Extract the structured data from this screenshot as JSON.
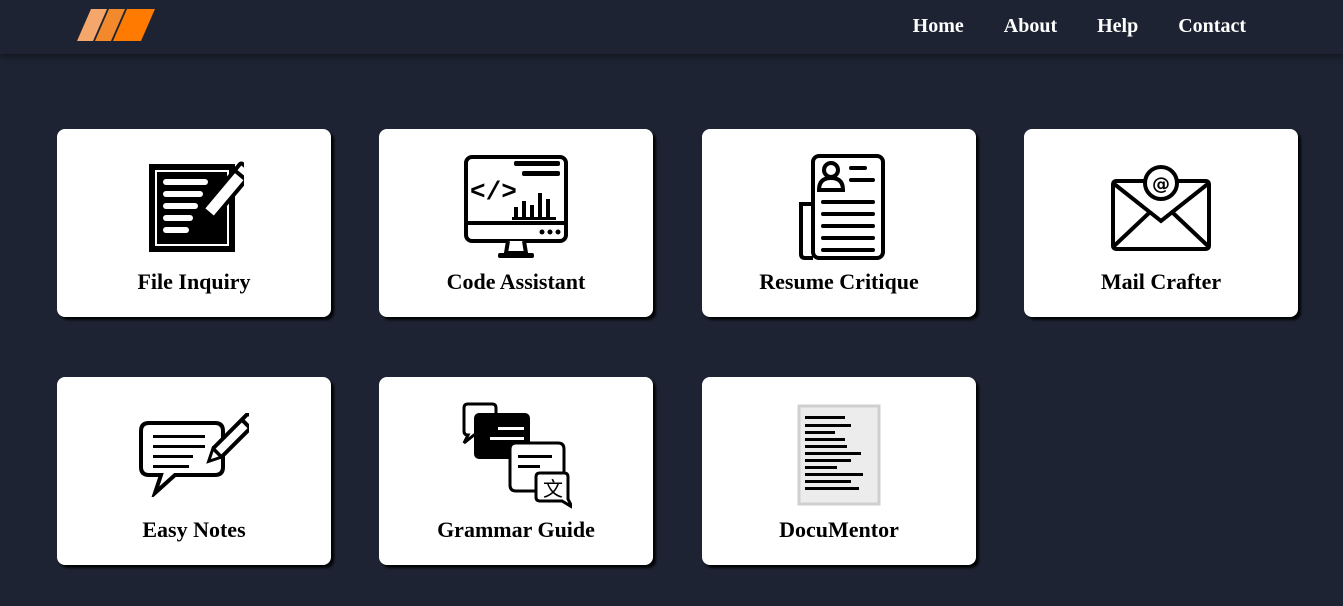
{
  "brand": {
    "logo_icon": "orange-slashes-logo-icon",
    "colors": [
      "#f5a76b",
      "#f28a2d",
      "#ff7a00"
    ]
  },
  "nav": {
    "items": [
      {
        "label": "Home"
      },
      {
        "label": "About"
      },
      {
        "label": "Help"
      },
      {
        "label": "Contact"
      }
    ]
  },
  "cards": [
    {
      "label": "File Inquiry",
      "icon": "document-edit-icon"
    },
    {
      "label": "Code Assistant",
      "icon": "code-monitor-icon"
    },
    {
      "label": "Resume Critique",
      "icon": "resume-icon"
    },
    {
      "label": "Mail Crafter",
      "icon": "email-envelope-icon"
    },
    {
      "label": "Easy Notes",
      "icon": "note-chat-pencil-icon"
    },
    {
      "label": "Grammar Guide",
      "icon": "translate-chat-icon"
    },
    {
      "label": "DocuMentor",
      "icon": "text-document-icon"
    }
  ],
  "theme": {
    "background": "#1d2332",
    "card": "#ffffff",
    "text": "#000000"
  }
}
